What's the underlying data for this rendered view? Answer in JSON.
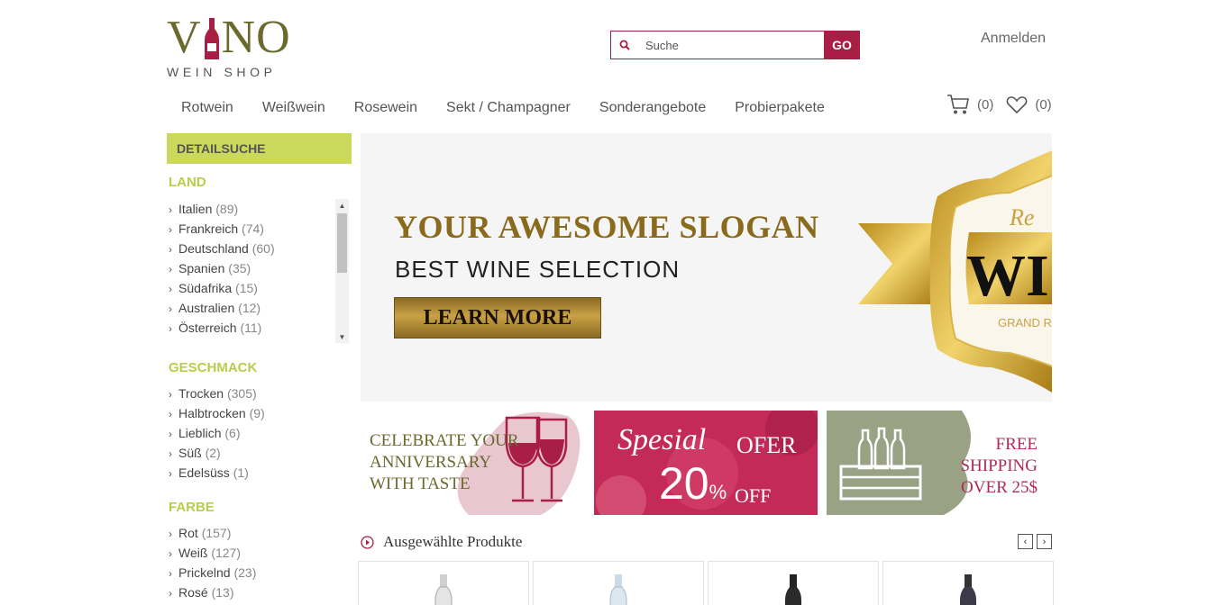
{
  "logo": {
    "word_left": "V",
    "word_right": "NO",
    "sub": "WEIN SHOP"
  },
  "search": {
    "placeholder": "Suche",
    "go_label": "GO"
  },
  "login_label": "Anmelden",
  "nav": [
    "Rotwein",
    "Weißwein",
    "Rosewein",
    "Sekt / Champagner",
    "Sonderangebote",
    "Probierpakete"
  ],
  "cart": {
    "count": "(0)"
  },
  "wishlist": {
    "count": "(0)"
  },
  "sidebar": {
    "header": "DETAILSUCHE",
    "land": {
      "title": "LAND",
      "items": [
        {
          "name": "Italien",
          "count": "(89)"
        },
        {
          "name": "Frankreich",
          "count": "(74)"
        },
        {
          "name": "Deutschland",
          "count": "(60)"
        },
        {
          "name": "Spanien",
          "count": "(35)"
        },
        {
          "name": "Südafrika",
          "count": "(15)"
        },
        {
          "name": "Australien",
          "count": "(12)"
        },
        {
          "name": "Österreich",
          "count": "(11)"
        }
      ]
    },
    "geschmack": {
      "title": "GESCHMACK",
      "items": [
        {
          "name": "Trocken",
          "count": "(305)"
        },
        {
          "name": "Halbtrocken",
          "count": "(9)"
        },
        {
          "name": "Lieblich",
          "count": "(6)"
        },
        {
          "name": "Süß",
          "count": "(2)"
        },
        {
          "name": "Edelsüss",
          "count": "(1)"
        }
      ]
    },
    "farbe": {
      "title": "FARBE",
      "items": [
        {
          "name": "Rot",
          "count": "(157)"
        },
        {
          "name": "Weiß",
          "count": "(127)"
        },
        {
          "name": "Prickelnd",
          "count": "(23)"
        },
        {
          "name": "Rosé",
          "count": "(13)"
        }
      ]
    }
  },
  "hero": {
    "slogan": "YOUR AWESOME SLOGAN",
    "subline": "BEST WINE SELECTION",
    "button": "LEARN MORE",
    "badge_script": "Re",
    "badge_big": "WI",
    "badge_small": "GRAND R"
  },
  "promos": {
    "p1": {
      "line1": "CELEBRATE YOUR",
      "line2": "ANNIVERSARY",
      "line3": "WITH TASTE"
    },
    "p2": {
      "spesial": "Spesial",
      "ofer": "OFER",
      "percent": "20",
      "pct_sign": "%",
      "off": "OFF"
    },
    "p3": {
      "line1": "FREE",
      "line2": "SHIPPING",
      "line3": "OVER 25$"
    }
  },
  "featured": {
    "title": "Ausgewählte Produkte"
  },
  "colors": {
    "accent": "#a91e44",
    "olive": "#6b6a2e",
    "lime": "#cbd85c",
    "gold": "#8a6b1e"
  }
}
